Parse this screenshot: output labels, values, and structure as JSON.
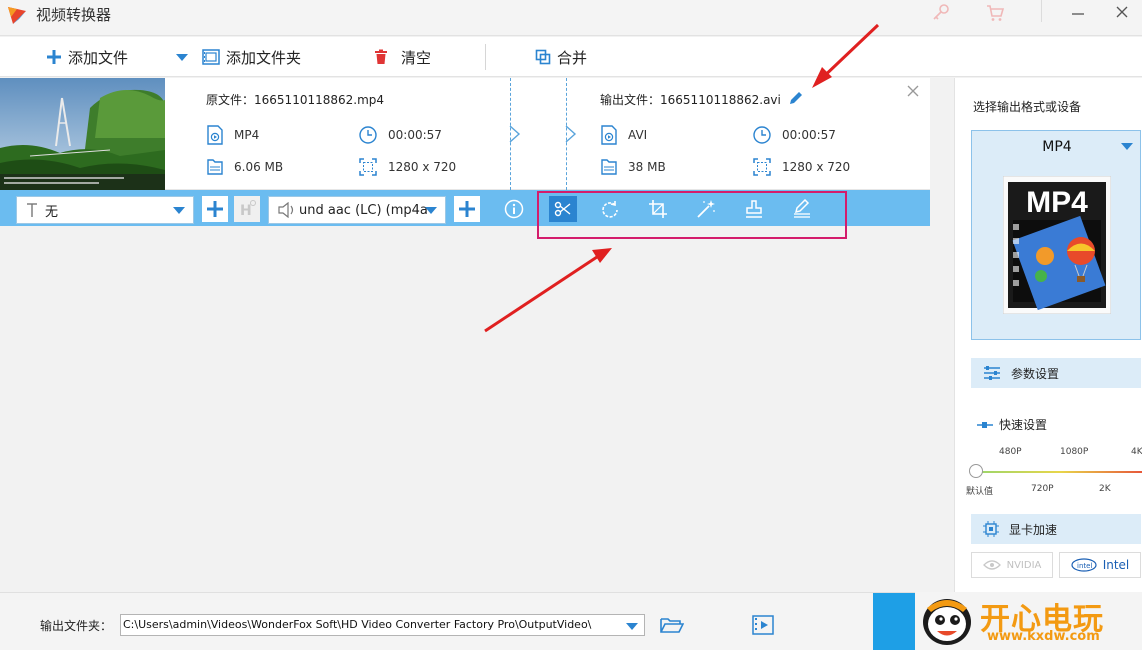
{
  "window": {
    "title": "视频转换器",
    "icons": [
      "key-icon",
      "cart-icon",
      "minimize-icon",
      "close-icon"
    ]
  },
  "toolbar": {
    "add_file": "添加文件",
    "add_folder": "添加文件夹",
    "clear": "清空",
    "merge": "合并"
  },
  "file_item": {
    "source_label": "原文件：",
    "source_name": "1665110118862.mp4",
    "source_format": "MP4",
    "source_duration": "00:00:57",
    "source_size": "6.06 MB",
    "source_resolution": "1280 x 720",
    "output_label": "输出文件：",
    "output_name": "1665110118862.avi",
    "output_format": "AVI",
    "output_duration": "00:00:57",
    "output_size": "38 MB",
    "output_resolution": "1280 x 720"
  },
  "edit_bar": {
    "subtitle_value": "无",
    "audio_value": "und aac (LC) (mp4a",
    "tools": [
      "scissors-icon",
      "rotate-icon",
      "crop-icon",
      "effects-wand-icon",
      "watermark-stamp-icon",
      "edit-pen-icon"
    ]
  },
  "right_panel": {
    "title": "选择输出格式或设备",
    "format": "MP4",
    "format_image_text": "MP4",
    "params_button": "参数设置",
    "quick_settings": "快速设置",
    "quality_ticks_top": [
      "480P",
      "1080P",
      "4K"
    ],
    "quality_ticks_bottom": [
      "默认值",
      "720P",
      "2K"
    ],
    "quality_level": 0,
    "gpu_button": "显卡加速",
    "gpu_nvidia": "NVIDIA",
    "gpu_intel": "Intel"
  },
  "bottom": {
    "output_folder_label": "输出文件夹：",
    "output_path": "C:\\Users\\admin\\Videos\\WonderFox Soft\\HD Video Converter Factory Pro\\OutputVideo\\"
  },
  "watermark": {
    "text": "开心电玩",
    "url": "www.kxdw.com"
  },
  "colors": {
    "accent_blue": "#6bbcf0",
    "annotation_red": "#e02020",
    "highlight_pink": "#d41c6c"
  }
}
